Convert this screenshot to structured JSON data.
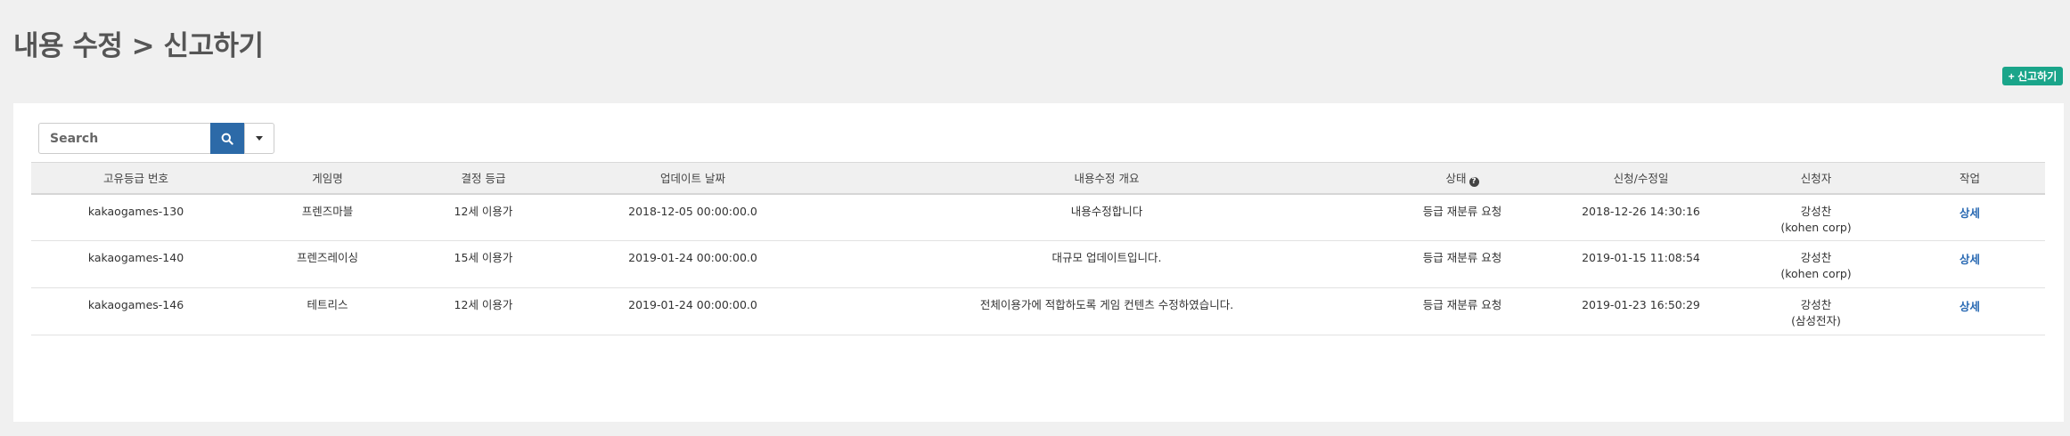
{
  "header": {
    "title": "내용 수정 > 신고하기",
    "report_button_label": "+ 신고하기"
  },
  "search": {
    "placeholder": "Search"
  },
  "table": {
    "columns": [
      "고유등급 번호",
      "게임명",
      "결정 등급",
      "업데이트 날짜",
      "내용수정 개요",
      "상태",
      "신청/수정일",
      "신청자",
      "작업"
    ],
    "rows": [
      {
        "id": "kakaogames-130",
        "game": "프렌즈마블",
        "rating": "12세 이용가",
        "updated": "2018-12-05 00:00:00.0",
        "summary": "내용수정합니다",
        "status": "등급 재분류 요청",
        "requested": "2018-12-26 14:30:16",
        "applicant_name": "강성찬",
        "applicant_org": "(kohen corp)",
        "action": "상세"
      },
      {
        "id": "kakaogames-140",
        "game": "프렌즈레이싱",
        "rating": "15세 이용가",
        "updated": "2019-01-24 00:00:00.0",
        "summary": "대규모 업데이트입니다.",
        "status": "등급 재분류 요청",
        "requested": "2019-01-15 11:08:54",
        "applicant_name": "강성찬",
        "applicant_org": "(kohen corp)",
        "action": "상세"
      },
      {
        "id": "kakaogames-146",
        "game": "테트리스",
        "rating": "12세 이용가",
        "updated": "2019-01-24 00:00:00.0",
        "summary": "전체이용가에 적합하도록 게임 컨텐츠 수정하였습니다.",
        "status": "등급 재분류 요청",
        "requested": "2019-01-23 16:50:29",
        "applicant_name": "강성찬",
        "applicant_org": "(삼성전자)",
        "action": "상세"
      }
    ]
  },
  "icons": {
    "search": "search-icon",
    "dropdown": "chevron-down-icon",
    "help": "question-circle-icon"
  },
  "colors": {
    "accent_green": "#1aa58a",
    "primary_blue": "#2c6aa8",
    "link_blue": "#2a6ab3"
  }
}
